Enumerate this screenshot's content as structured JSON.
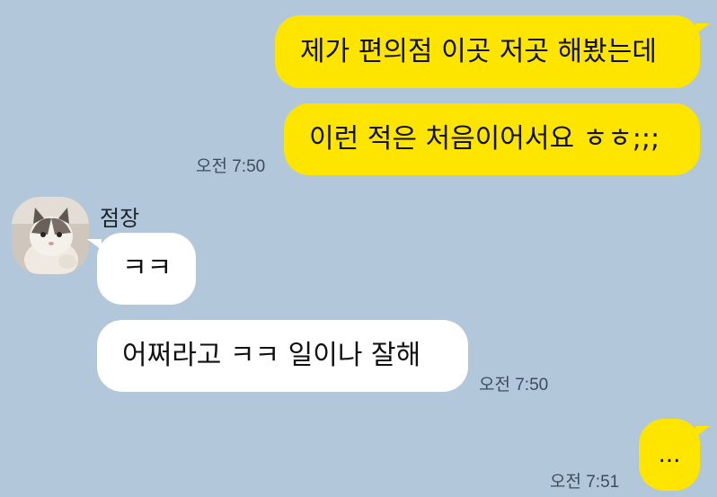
{
  "messages": {
    "out1": "제가 편의점 이곳 저곳 해봤는데",
    "out2": "이런 적은 처음이어서요 ㅎㅎ;;;",
    "in1": "ㅋㅋ",
    "in2": "어쩌라고 ㅋㅋ 일이나 잘해",
    "out3": "..."
  },
  "timestamps": {
    "out_group1": "오전 7:50",
    "in_group": "오전 7:50",
    "out_group2": "오전 7:51"
  },
  "sender": {
    "name": "점장",
    "avatar_icon": "cat-profile-photo"
  },
  "colors": {
    "background": "#b2c7da",
    "outgoing_bubble": "#fee500",
    "incoming_bubble": "#ffffff"
  }
}
